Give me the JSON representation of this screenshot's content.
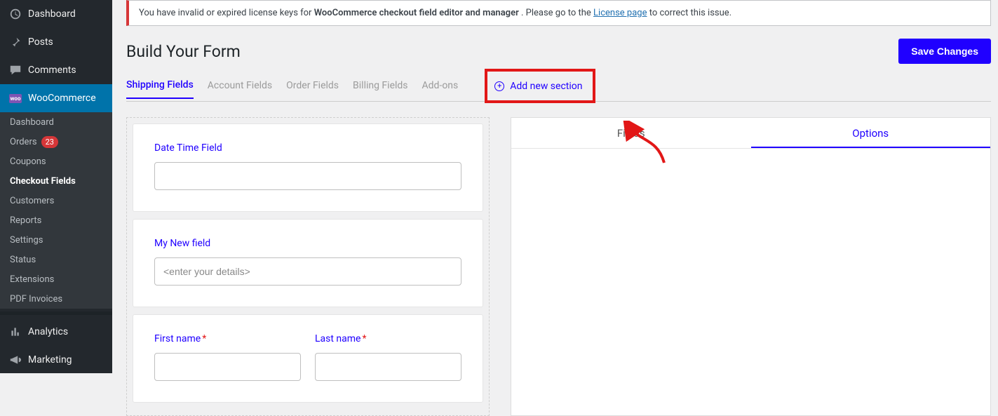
{
  "sidebar": {
    "top": [
      {
        "icon": "dashboard",
        "label": "Dashboard"
      },
      {
        "icon": "pin",
        "label": "Posts"
      },
      {
        "icon": "comment",
        "label": "Comments"
      },
      {
        "icon": "woo",
        "label": "WooCommerce",
        "current": true
      }
    ],
    "sub": [
      {
        "label": "Dashboard"
      },
      {
        "label": "Orders",
        "badge": "23"
      },
      {
        "label": "Coupons"
      },
      {
        "label": "Checkout Fields",
        "current": true
      },
      {
        "label": "Customers"
      },
      {
        "label": "Reports"
      },
      {
        "label": "Settings"
      },
      {
        "label": "Status"
      },
      {
        "label": "Extensions"
      },
      {
        "label": "PDF Invoices"
      }
    ],
    "bottom": [
      {
        "icon": "analytics",
        "label": "Analytics"
      },
      {
        "icon": "bullhorn",
        "label": "Marketing"
      }
    ]
  },
  "notice": {
    "pre": "You have invalid or expired license keys for ",
    "bold": "WooCommerce checkout field editor and manager",
    "mid": ". Please go to the ",
    "link": "License page",
    "post": " to correct this issue."
  },
  "header": {
    "title": "Build Your Form",
    "save_label": "Save Changes"
  },
  "tabs": {
    "items": [
      "Shipping Fields",
      "Account Fields",
      "Order Fields",
      "Billing Fields",
      "Add-ons"
    ],
    "active_index": 0,
    "add_section_label": "Add new section"
  },
  "cards": {
    "c1": {
      "label": "Date Time Field",
      "placeholder": ""
    },
    "c2": {
      "label": "My New field",
      "placeholder": "<enter your details>"
    },
    "c3": {
      "first_label": "First name",
      "last_label": "Last name",
      "required": "*"
    }
  },
  "side": {
    "tabs": [
      "Fields",
      "Options"
    ],
    "active_index": 1
  }
}
